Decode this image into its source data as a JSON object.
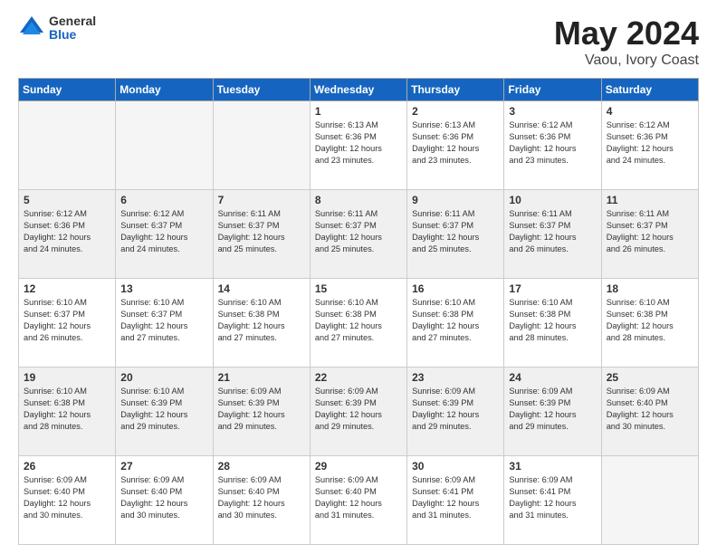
{
  "logo": {
    "general": "General",
    "blue": "Blue"
  },
  "title": {
    "month": "May 2024",
    "location": "Vaou, Ivory Coast"
  },
  "days_header": [
    "Sunday",
    "Monday",
    "Tuesday",
    "Wednesday",
    "Thursday",
    "Friday",
    "Saturday"
  ],
  "weeks": [
    {
      "shaded": false,
      "days": [
        {
          "num": "",
          "info": ""
        },
        {
          "num": "",
          "info": ""
        },
        {
          "num": "",
          "info": ""
        },
        {
          "num": "1",
          "info": "Sunrise: 6:13 AM\nSunset: 6:36 PM\nDaylight: 12 hours\nand 23 minutes."
        },
        {
          "num": "2",
          "info": "Sunrise: 6:13 AM\nSunset: 6:36 PM\nDaylight: 12 hours\nand 23 minutes."
        },
        {
          "num": "3",
          "info": "Sunrise: 6:12 AM\nSunset: 6:36 PM\nDaylight: 12 hours\nand 23 minutes."
        },
        {
          "num": "4",
          "info": "Sunrise: 6:12 AM\nSunset: 6:36 PM\nDaylight: 12 hours\nand 24 minutes."
        }
      ]
    },
    {
      "shaded": true,
      "days": [
        {
          "num": "5",
          "info": "Sunrise: 6:12 AM\nSunset: 6:36 PM\nDaylight: 12 hours\nand 24 minutes."
        },
        {
          "num": "6",
          "info": "Sunrise: 6:12 AM\nSunset: 6:37 PM\nDaylight: 12 hours\nand 24 minutes."
        },
        {
          "num": "7",
          "info": "Sunrise: 6:11 AM\nSunset: 6:37 PM\nDaylight: 12 hours\nand 25 minutes."
        },
        {
          "num": "8",
          "info": "Sunrise: 6:11 AM\nSunset: 6:37 PM\nDaylight: 12 hours\nand 25 minutes."
        },
        {
          "num": "9",
          "info": "Sunrise: 6:11 AM\nSunset: 6:37 PM\nDaylight: 12 hours\nand 25 minutes."
        },
        {
          "num": "10",
          "info": "Sunrise: 6:11 AM\nSunset: 6:37 PM\nDaylight: 12 hours\nand 26 minutes."
        },
        {
          "num": "11",
          "info": "Sunrise: 6:11 AM\nSunset: 6:37 PM\nDaylight: 12 hours\nand 26 minutes."
        }
      ]
    },
    {
      "shaded": false,
      "days": [
        {
          "num": "12",
          "info": "Sunrise: 6:10 AM\nSunset: 6:37 PM\nDaylight: 12 hours\nand 26 minutes."
        },
        {
          "num": "13",
          "info": "Sunrise: 6:10 AM\nSunset: 6:37 PM\nDaylight: 12 hours\nand 27 minutes."
        },
        {
          "num": "14",
          "info": "Sunrise: 6:10 AM\nSunset: 6:38 PM\nDaylight: 12 hours\nand 27 minutes."
        },
        {
          "num": "15",
          "info": "Sunrise: 6:10 AM\nSunset: 6:38 PM\nDaylight: 12 hours\nand 27 minutes."
        },
        {
          "num": "16",
          "info": "Sunrise: 6:10 AM\nSunset: 6:38 PM\nDaylight: 12 hours\nand 27 minutes."
        },
        {
          "num": "17",
          "info": "Sunrise: 6:10 AM\nSunset: 6:38 PM\nDaylight: 12 hours\nand 28 minutes."
        },
        {
          "num": "18",
          "info": "Sunrise: 6:10 AM\nSunset: 6:38 PM\nDaylight: 12 hours\nand 28 minutes."
        }
      ]
    },
    {
      "shaded": true,
      "days": [
        {
          "num": "19",
          "info": "Sunrise: 6:10 AM\nSunset: 6:38 PM\nDaylight: 12 hours\nand 28 minutes."
        },
        {
          "num": "20",
          "info": "Sunrise: 6:10 AM\nSunset: 6:39 PM\nDaylight: 12 hours\nand 29 minutes."
        },
        {
          "num": "21",
          "info": "Sunrise: 6:09 AM\nSunset: 6:39 PM\nDaylight: 12 hours\nand 29 minutes."
        },
        {
          "num": "22",
          "info": "Sunrise: 6:09 AM\nSunset: 6:39 PM\nDaylight: 12 hours\nand 29 minutes."
        },
        {
          "num": "23",
          "info": "Sunrise: 6:09 AM\nSunset: 6:39 PM\nDaylight: 12 hours\nand 29 minutes."
        },
        {
          "num": "24",
          "info": "Sunrise: 6:09 AM\nSunset: 6:39 PM\nDaylight: 12 hours\nand 29 minutes."
        },
        {
          "num": "25",
          "info": "Sunrise: 6:09 AM\nSunset: 6:40 PM\nDaylight: 12 hours\nand 30 minutes."
        }
      ]
    },
    {
      "shaded": false,
      "days": [
        {
          "num": "26",
          "info": "Sunrise: 6:09 AM\nSunset: 6:40 PM\nDaylight: 12 hours\nand 30 minutes."
        },
        {
          "num": "27",
          "info": "Sunrise: 6:09 AM\nSunset: 6:40 PM\nDaylight: 12 hours\nand 30 minutes."
        },
        {
          "num": "28",
          "info": "Sunrise: 6:09 AM\nSunset: 6:40 PM\nDaylight: 12 hours\nand 30 minutes."
        },
        {
          "num": "29",
          "info": "Sunrise: 6:09 AM\nSunset: 6:40 PM\nDaylight: 12 hours\nand 31 minutes."
        },
        {
          "num": "30",
          "info": "Sunrise: 6:09 AM\nSunset: 6:41 PM\nDaylight: 12 hours\nand 31 minutes."
        },
        {
          "num": "31",
          "info": "Sunrise: 6:09 AM\nSunset: 6:41 PM\nDaylight: 12 hours\nand 31 minutes."
        },
        {
          "num": "",
          "info": ""
        }
      ]
    }
  ]
}
